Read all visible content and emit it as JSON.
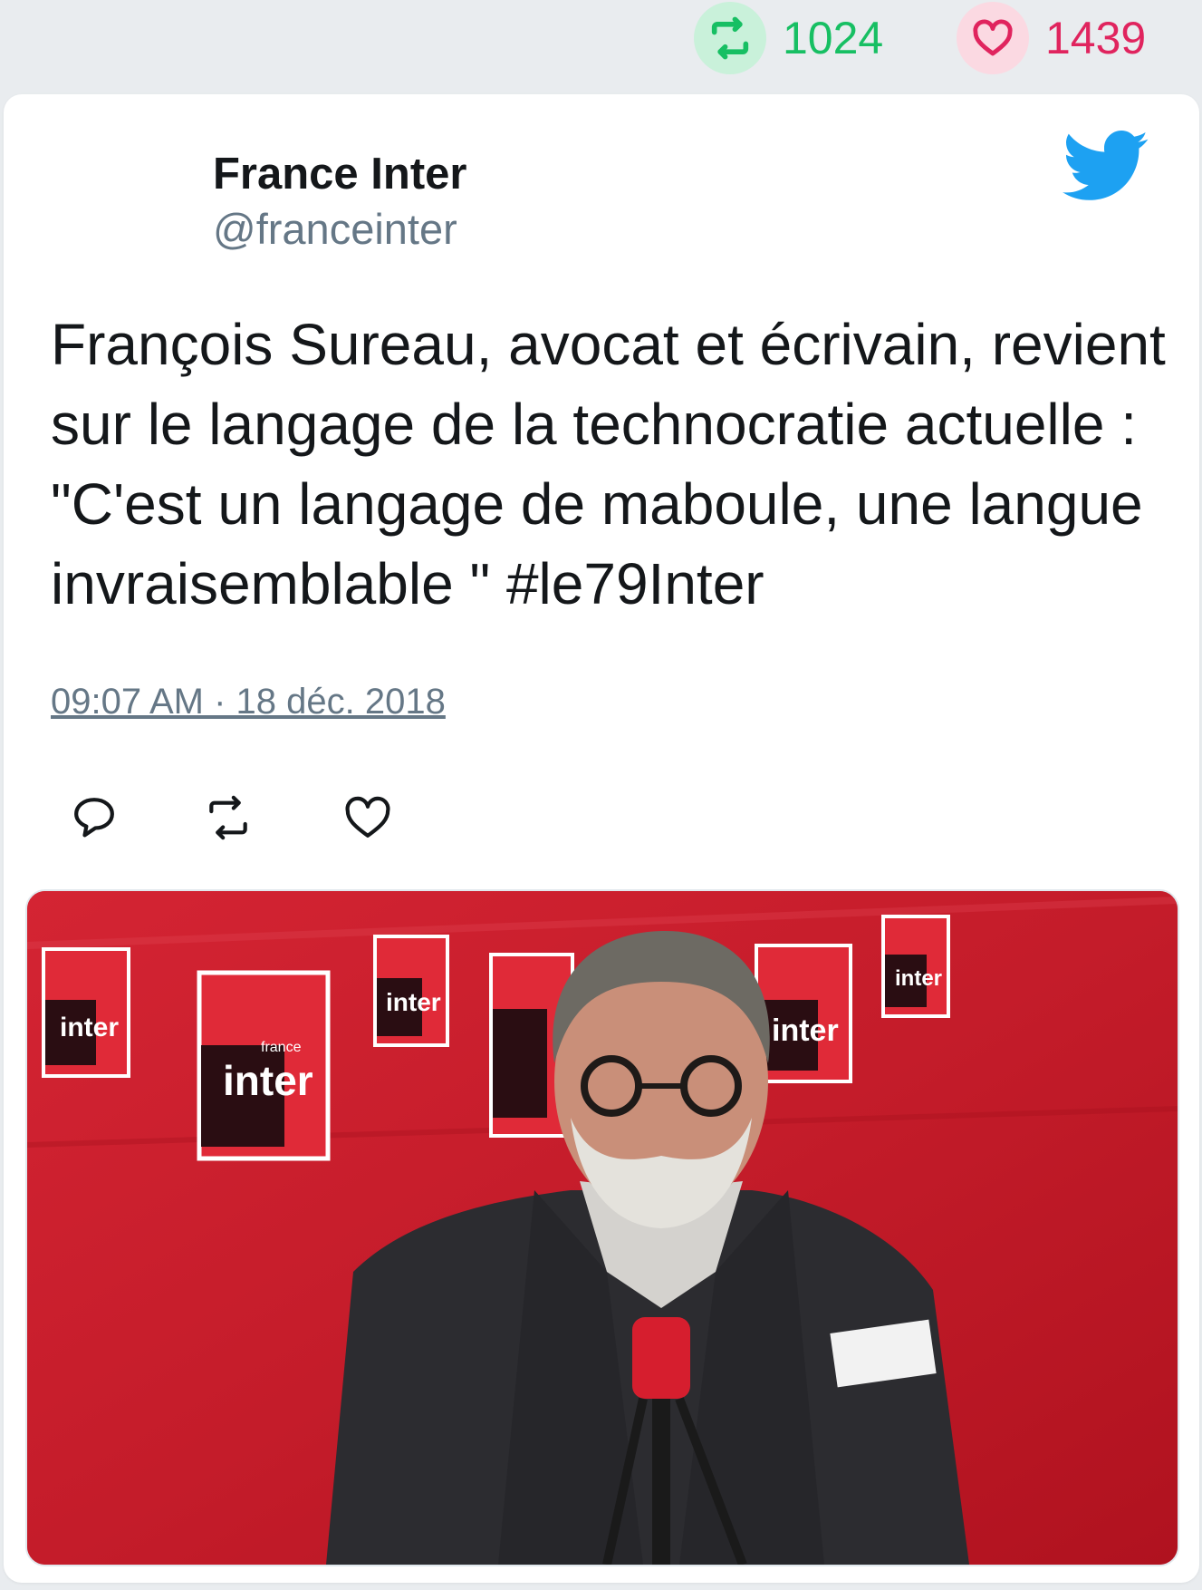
{
  "stats": {
    "retweet_count": "1024",
    "like_count": "1439"
  },
  "tweet": {
    "author_name": "France Inter",
    "author_handle": "@franceinter",
    "text": "François Sureau, avocat et écrivain, revient sur le langage de la technocratie actuelle : \"C'est un langage de maboule, une langue invraisemblable \" #le79Inter",
    "timestamp": "09:07 AM · 18 déc. 2018"
  },
  "media": {
    "logo_word": "inter",
    "logo_small": "france"
  },
  "icons": {
    "retweet": "retweet-icon",
    "like": "heart-icon",
    "reply": "reply-icon",
    "brand": "twitter-bird-icon"
  },
  "colors": {
    "retweet": "#17bf63",
    "like": "#e0245e",
    "twitter_blue": "#1da1f2",
    "text": "#14171a",
    "muted": "#657786",
    "background": "#e9ecef",
    "studio_red": "#c91d2b"
  }
}
